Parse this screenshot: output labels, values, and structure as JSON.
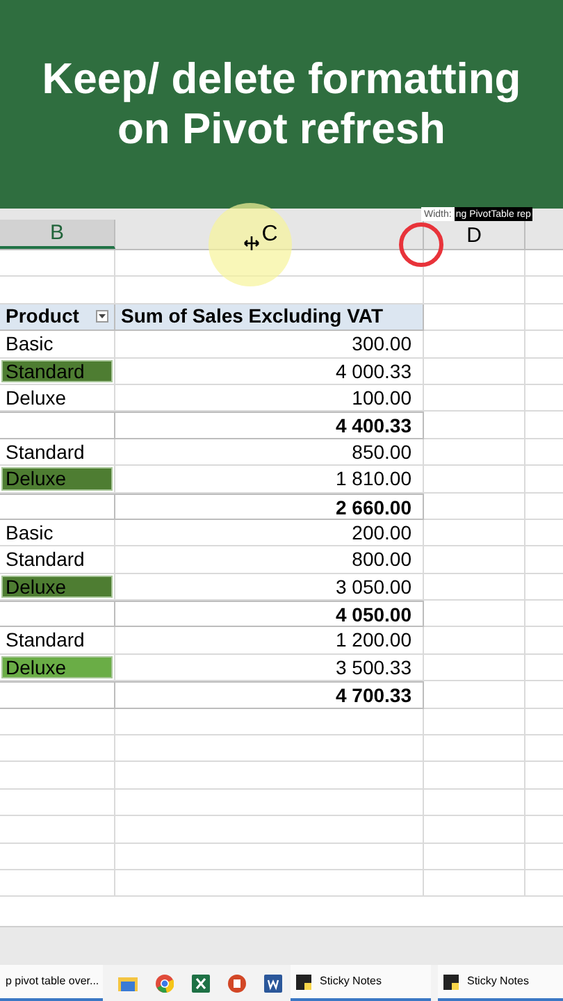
{
  "banner": {
    "title": "Keep/ delete formatting on Pivot refresh"
  },
  "columns": [
    {
      "label": "B",
      "selected": true
    },
    {
      "label": "C",
      "selected": false
    },
    {
      "label": "D",
      "selected": false
    }
  ],
  "tooltip": {
    "label": "Width:",
    "text": "ng PivotTable rep"
  },
  "pivot": {
    "headers": [
      "Product",
      "Sum of Sales Excluding VAT"
    ],
    "rows": [
      {
        "kind": "item",
        "product": "Basic",
        "value": "300.00"
      },
      {
        "kind": "item",
        "product": "Standard",
        "value": "4 000.33",
        "color": "#4e7d32"
      },
      {
        "kind": "item",
        "product": "Deluxe",
        "value": "100.00"
      },
      {
        "kind": "total",
        "value": "4 400.33"
      },
      {
        "kind": "item",
        "product": "Standard",
        "value": "850.00"
      },
      {
        "kind": "item",
        "product": "Deluxe",
        "value": "1 810.00",
        "color": "#4e7d32"
      },
      {
        "kind": "total",
        "value": "2 660.00"
      },
      {
        "kind": "item",
        "product": "Basic",
        "value": "200.00"
      },
      {
        "kind": "item",
        "product": "Standard",
        "value": "800.00"
      },
      {
        "kind": "item",
        "product": "Deluxe",
        "value": "3 050.00",
        "color": "#4e7d32"
      },
      {
        "kind": "total",
        "value": "4 050.00"
      },
      {
        "kind": "item",
        "product": "Standard",
        "value": "1 200.00"
      },
      {
        "kind": "item",
        "product": "Deluxe",
        "value": "3 500.33",
        "color": "#6aad46"
      },
      {
        "kind": "total",
        "value": "4 700.33"
      }
    ]
  },
  "taskbar": [
    {
      "kind": "window",
      "label": "p pivot table over..."
    },
    {
      "kind": "folder"
    },
    {
      "kind": "browser"
    },
    {
      "kind": "spreadsheet"
    },
    {
      "kind": "presentation"
    },
    {
      "kind": "document"
    },
    {
      "kind": "note",
      "label": "Sticky Notes"
    },
    {
      "kind": "note",
      "label": "Sticky Notes"
    }
  ]
}
